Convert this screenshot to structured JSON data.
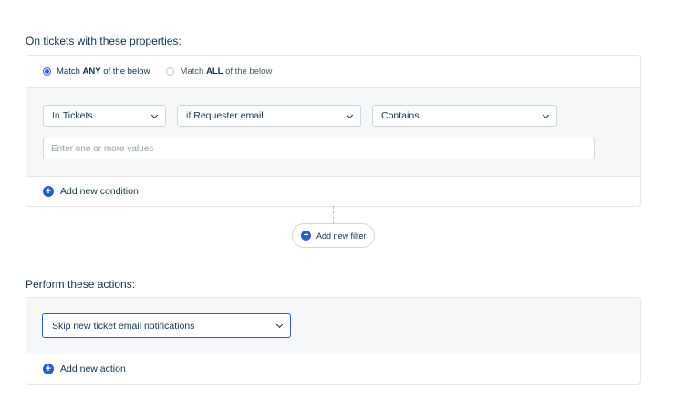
{
  "conditions_section": {
    "title": "On tickets with these properties:",
    "match_any": {
      "prefix": "Match ",
      "strong": "ANY",
      "suffix": " of the below"
    },
    "match_all": {
      "prefix": "Match ",
      "strong": "ALL",
      "suffix": " of the below"
    },
    "condition": {
      "scope": {
        "prefix": "In",
        "value": "Tickets"
      },
      "field": {
        "prefix": "if",
        "value": "Requester email"
      },
      "operator": {
        "value": "Contains"
      },
      "values_placeholder": "Enter one or more values"
    },
    "add_condition_label": "Add new condition"
  },
  "add_filter_label": "Add new filter",
  "actions_section": {
    "title": "Perform these actions:",
    "action_value": "Skip new ticket email notifications",
    "add_action_label": "Add new action"
  },
  "colors": {
    "accent": "#2c5cc5",
    "text": "#12344d",
    "muted_bg": "#f5f7f9",
    "border": "#e4e7ec"
  },
  "icons": {
    "plus": "plus-circle-icon",
    "chevron": "chevron-down-icon"
  }
}
